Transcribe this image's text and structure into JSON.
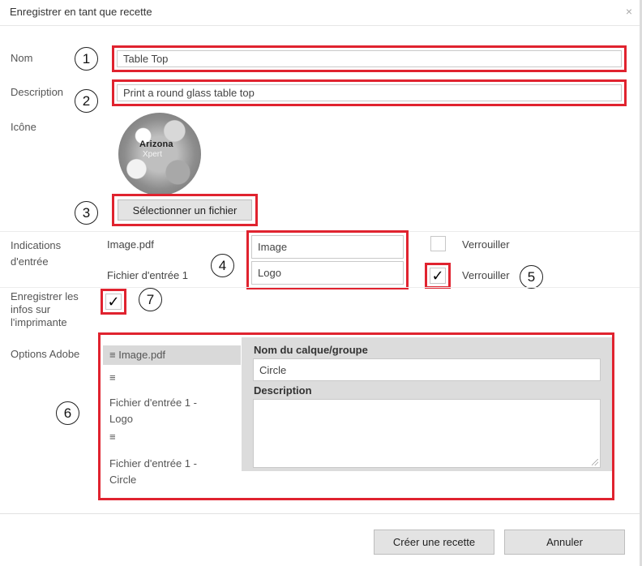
{
  "dialog": {
    "title": "Enregistrer en tant que recette",
    "close_glyph": "×"
  },
  "form": {
    "name_label": "Nom",
    "name_value": "Table Top",
    "description_label": "Description",
    "description_value": "Print a round glass table top",
    "icon_label": "Icône",
    "icon_logo_text": "Arizona",
    "icon_logo_sub": "Xpert",
    "select_file_label": "Sélectionner un fichier"
  },
  "input_hints": {
    "label_line1": "Indications",
    "label_line2": "d'entrée",
    "rows": [
      {
        "file": "Image.pdf",
        "value": "Image",
        "lock_label": "Verrouiller",
        "locked": false
      },
      {
        "file": "Fichier d'entrée 1",
        "value": "Logo",
        "lock_label": "Verrouiller",
        "locked": true
      }
    ]
  },
  "save_printer": {
    "label_line1": "Enregistrer les",
    "label_line2": "infos sur",
    "label_line3": "l'imprimante",
    "checked": true
  },
  "adobe": {
    "label": "Options Adobe",
    "list": [
      {
        "icon": "≡",
        "text": "Image.pdf",
        "selected": true
      },
      {
        "icon": "≡",
        "text_line1": "Fichier d'entrée 1 -",
        "text_line2": "Logo"
      },
      {
        "icon": "≡",
        "text_line1": "Fichier d'entrée 1 -",
        "text_line2": "Circle"
      }
    ],
    "layer_label": "Nom du calque/groupe",
    "layer_value": "Circle",
    "desc_label": "Description",
    "desc_value": ""
  },
  "callouts": [
    "1",
    "2",
    "3",
    "4",
    "5",
    "6",
    "7"
  ],
  "check_glyph": "✓",
  "footer": {
    "create_label": "Créer une recette",
    "cancel_label": "Annuler"
  },
  "colors": {
    "annotation_red": "#e0232f",
    "selected_item_bg": "#d9d9d9",
    "detail_panel_bg": "#dcdcdc"
  }
}
